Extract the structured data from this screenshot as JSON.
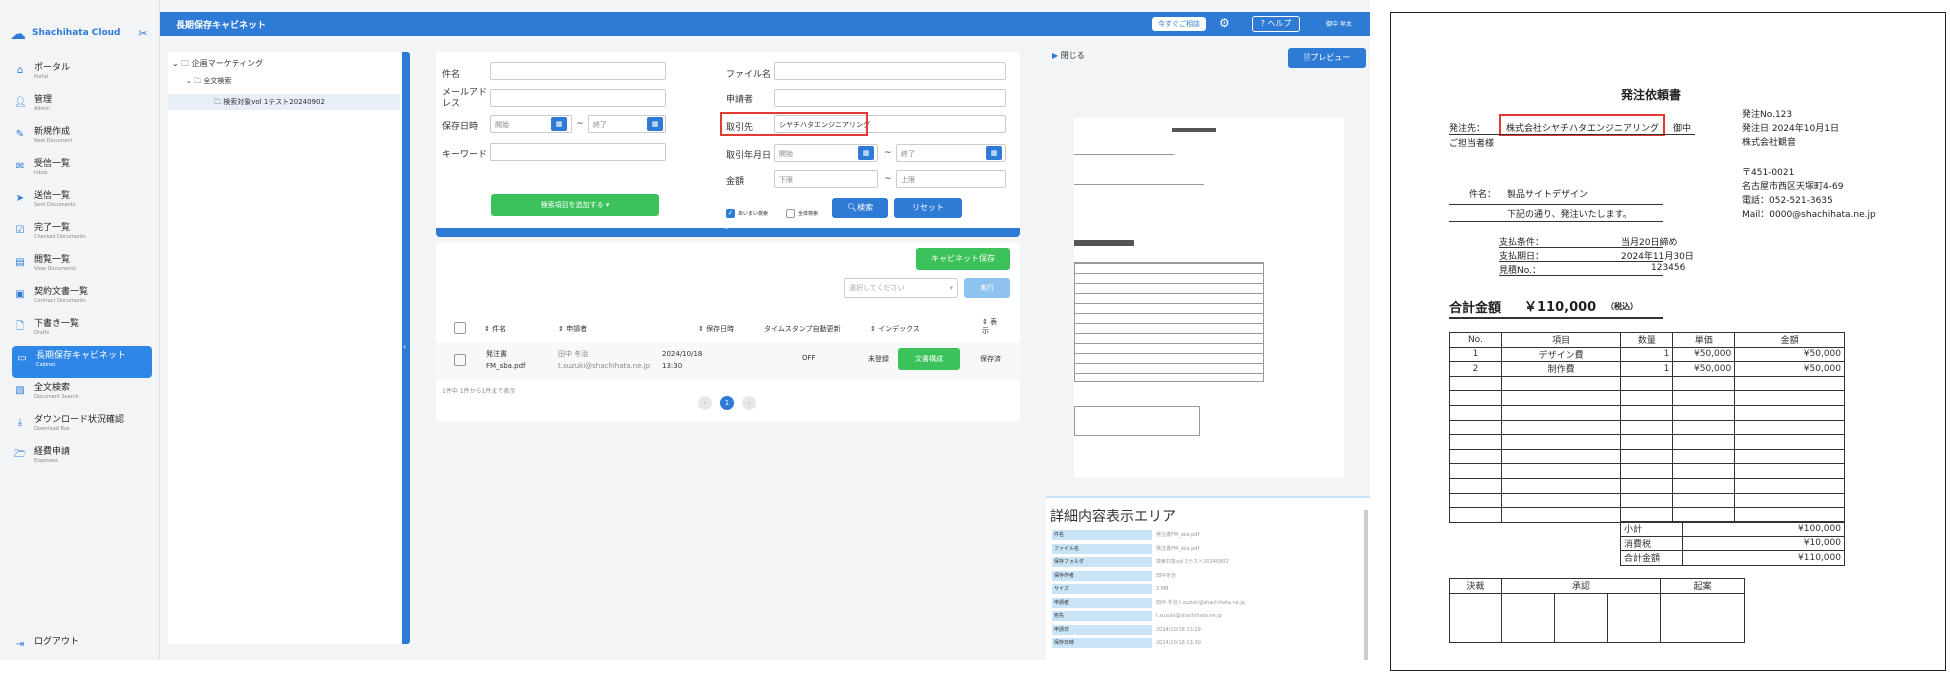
{
  "app": {
    "brand": "Shachihata Cloud",
    "page_title": "長期保存キャビネット",
    "topbar": {
      "quick_consult": "今すぐご相談",
      "help": "ヘルプ",
      "user": "御中 早太"
    },
    "sidebar": {
      "items": [
        {
          "label": "ポータル",
          "sub": "Portal"
        },
        {
          "label": "管理",
          "sub": "Admin"
        },
        {
          "label": "新規作成",
          "sub": "New Document"
        },
        {
          "label": "受信一覧",
          "sub": "Inbox"
        },
        {
          "label": "送信一覧",
          "sub": "Sent Documents"
        },
        {
          "label": "完了一覧",
          "sub": "Checked Documents"
        },
        {
          "label": "閲覧一覧",
          "sub": "View Documents"
        },
        {
          "label": "契約文書一覧",
          "sub": "Contract Documents"
        },
        {
          "label": "下書き一覧",
          "sub": "Drafts"
        },
        {
          "label": "長期保存キャビネット",
          "sub": "Cabinet"
        },
        {
          "label": "全文検索",
          "sub": "Document Search"
        },
        {
          "label": "ダウンロード状況確認",
          "sub": "Download Box"
        },
        {
          "label": "経費申請",
          "sub": "Expenses"
        }
      ],
      "logout": "ログアウト"
    },
    "tree": {
      "root": "企画マーケティング",
      "child": "全文検索",
      "leaf": "検索対象vol 1テスト20240902"
    },
    "search": {
      "name_label": "件名",
      "mail_label": "メールアドレス",
      "date_label": "保存日時",
      "start_ph": "開始",
      "end_ph": "終了",
      "keyword_label": "キーワード",
      "add_btn": "検索項目を追加する ▾",
      "file_label": "ファイル名",
      "applicant_label": "申請者",
      "client_label": "取引先",
      "client_value": "シヤチハタエンジニアリング",
      "trade_date_label": "取引年月日",
      "amount_label": "金額",
      "lower_ph": "下限",
      "upper_ph": "上限",
      "check1": "あいまい検索",
      "check2": "全体検索",
      "search_btn": "検索",
      "reset_btn": "リセット"
    },
    "results": {
      "save_btn": "キャビネット保存",
      "select_ph": "選択してください",
      "run_btn": "実行",
      "columns": [
        "件名",
        "申請者",
        "保存日時",
        "タイムスタンプ自動更新",
        "インデックス",
        "表示"
      ],
      "row": {
        "name": "発注書FM_sba.pdf",
        "applicant": "田中 冬治",
        "applicant_mail": "t.suzuki@shachihata.ne.jp",
        "date": "2024/10/18",
        "time": "13:30",
        "timestamp": "OFF",
        "index": "未登録",
        "index_btn": "文書構成",
        "display": "保存済"
      },
      "summary": "1件中 1件から1件まで表示",
      "page": "1"
    },
    "preview": {
      "close": "閉じる",
      "preview_btn": "プレビュー",
      "detail_title": "詳細内容表示エリア",
      "details": [
        {
          "k": "件名",
          "v": "発注書FM_sba.pdf"
        },
        {
          "k": "ファイル名",
          "v": "発注書FM_sba.pdf"
        },
        {
          "k": "保存フォルダ",
          "v": "検索対象vol 1テスト20240902"
        },
        {
          "k": "保存作者",
          "v": "田中冬治"
        },
        {
          "k": "サイズ",
          "v": "3 MB"
        },
        {
          "k": "申請者",
          "v": "田中 冬治 t.suzuki@shachihata.ne.jp"
        },
        {
          "k": "宛先",
          "v": "t.suzuki@shachihata.ne.jp"
        },
        {
          "k": "申請日",
          "v": "2024/10/18 13:29"
        },
        {
          "k": "保存日時",
          "v": "2024/10/18 13:30"
        }
      ]
    }
  },
  "document": {
    "title": "発注依頼書",
    "to_label": "発注先：",
    "to_company": "株式会社シヤチハタエンジニアリング",
    "to_suffix": "御中",
    "to_person": "ご担当者様",
    "order_no": "発注No.123",
    "order_date": "発注日 2024年10月1日",
    "issuer": "株式会社観音",
    "zip": "〒451-0021",
    "address": "名古屋市西区天塚町4-69",
    "tel": "電話：052-521-3635",
    "mail": "Mail：0000@shachihata.ne.jp",
    "subject_label": "件名：",
    "subject": "製品サイトデザイン",
    "message": "下記の通り、発注いたします。",
    "terms": [
      {
        "k": "支払条件：",
        "v": "当月20日締め"
      },
      {
        "k": "支払期日：",
        "v": "2024年11月30日"
      },
      {
        "k": "見積No.：",
        "v": "123456"
      }
    ],
    "total_label": "合計金額",
    "total_value": "￥110,000",
    "tax_note": "（税込）",
    "item_columns": [
      "No.",
      "項目",
      "数量",
      "単価",
      "金額"
    ],
    "items": [
      {
        "no": "1",
        "name": "デザイン費",
        "qty": "1",
        "price": "¥50,000",
        "amount": "¥50,000"
      },
      {
        "no": "2",
        "name": "制作費",
        "qty": "1",
        "price": "¥50,000",
        "amount": "¥50,000"
      }
    ],
    "summary": [
      {
        "k": "小計",
        "v": "¥100,000"
      },
      {
        "k": "消費税",
        "v": "¥10,000"
      },
      {
        "k": "合計金額",
        "v": "¥110,000"
      }
    ],
    "approval": [
      "決裁",
      "承認",
      "起案"
    ]
  },
  "colors": {
    "brand_blue": "#2e7bd6",
    "green": "#3cc25a",
    "highlight_red": "#e53935"
  }
}
